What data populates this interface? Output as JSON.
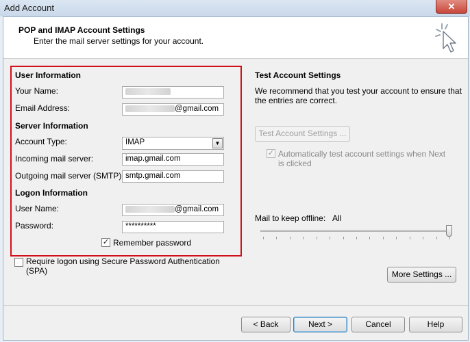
{
  "window": {
    "title": "Add Account",
    "close_glyph": "✕"
  },
  "header": {
    "title": "POP and IMAP Account Settings",
    "subtitle": "Enter the mail server settings for your account."
  },
  "user_information": {
    "heading": "User Information",
    "name_label": "Your Name:",
    "email_label": "Email Address:",
    "email_suffix": "@gmail.com"
  },
  "server_information": {
    "heading": "Server Information",
    "account_type_label": "Account Type:",
    "account_type_value": "IMAP",
    "incoming_label": "Incoming mail server:",
    "incoming_value": "imap.gmail.com",
    "outgoing_label": "Outgoing mail server (SMTP):",
    "outgoing_value": "smtp.gmail.com"
  },
  "logon_information": {
    "heading": "Logon Information",
    "username_label": "User Name:",
    "username_suffix": "@gmail.com",
    "password_label": "Password:",
    "password_value": "**********",
    "remember_label": "Remember password",
    "remember_checked": true
  },
  "spa": {
    "label_line1": "Require logon using Secure Password Authentication",
    "label_line2": "(SPA)",
    "checked": false
  },
  "test_settings": {
    "heading": "Test Account Settings",
    "description_line1": "We recommend that you test your account to ensure that",
    "description_line2": "the entries are correct.",
    "test_button": "Test Account Settings ...",
    "auto_test_line1": "Automatically test account settings when Next",
    "auto_test_line2": "is clicked",
    "auto_test_checked": true
  },
  "offline": {
    "label": "Mail to keep offline:",
    "value": "All",
    "slider_fraction": 1.0
  },
  "buttons": {
    "more_settings": "More Settings ...",
    "back": "< Back",
    "next": "Next >",
    "cancel": "Cancel",
    "help": "Help"
  },
  "icons": {
    "header_icon": "cursor-sparkle-icon",
    "check_glyph": "✓"
  },
  "colors": {
    "highlight_box": "#d0101a",
    "default_button_border": "#3c7fb1"
  }
}
